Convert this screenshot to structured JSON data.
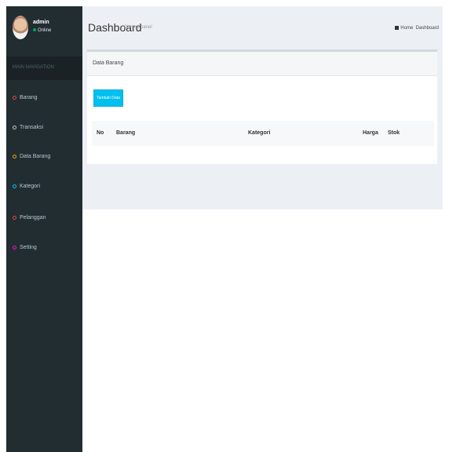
{
  "user": {
    "name": "admin",
    "status": "Online"
  },
  "sidebar": {
    "header": "MAIN NAVIGATION",
    "items": [
      {
        "label": "Barang",
        "color": "#dd4b39"
      },
      {
        "label": "Transaksi",
        "color": "#b8c7ce"
      },
      {
        "label": "Data Barang",
        "color": "#f39c12"
      },
      {
        "label": "Kategori",
        "color": "#00c0ef"
      },
      {
        "label": "Pelanggan",
        "color": "#dd4b39"
      },
      {
        "label": "Setting",
        "color": "#f012be"
      }
    ]
  },
  "page": {
    "title": "Dashboard",
    "subtitle": "Control panel"
  },
  "breadcrumb": {
    "home": "Home",
    "current": "Dashboard"
  },
  "box": {
    "title": "Data Barang",
    "add_button": "Tambah Data"
  },
  "table": {
    "columns": [
      "No",
      "Barang",
      "Kategori",
      "Harga",
      "Stok"
    ]
  }
}
